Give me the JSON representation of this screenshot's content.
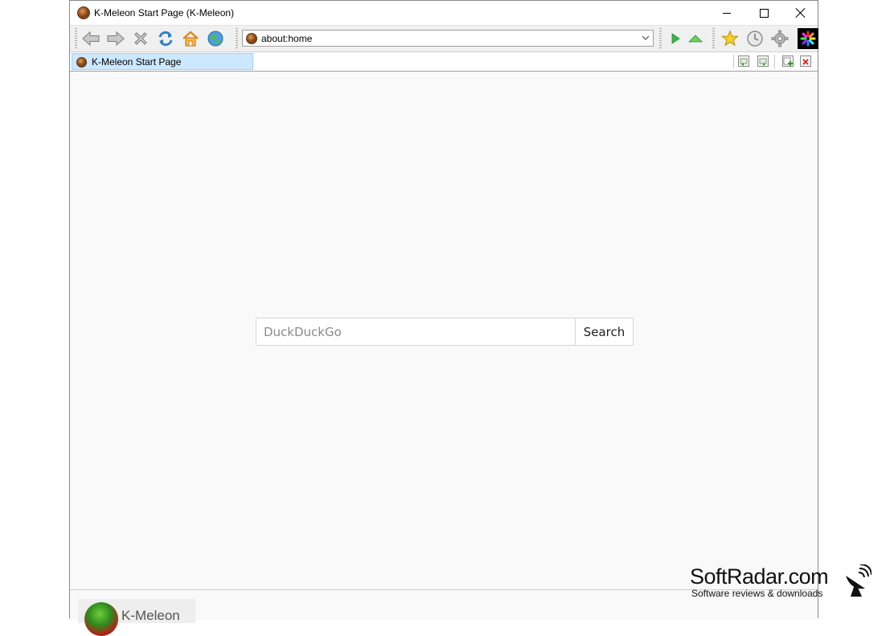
{
  "window": {
    "title": "K-Meleon Start Page (K-Meleon)"
  },
  "toolbar": {
    "back_icon": "back-arrow-icon",
    "forward_icon": "forward-arrow-icon",
    "stop_icon": "stop-x-icon",
    "reload_icon": "reload-icon",
    "home_icon": "home-icon",
    "globe_icon": "globe-icon",
    "go_icon": "go-play-icon",
    "up_icon": "up-triangle-icon",
    "bookmarks_icon": "star-icon",
    "history_icon": "clock-icon",
    "preferences_icon": "gear-icon",
    "throbber_icon": "kmeleon-throbber-icon"
  },
  "address_bar": {
    "value": "about:home"
  },
  "tabs": [
    {
      "label": "K-Meleon Start Page",
      "active": true
    }
  ],
  "content": {
    "search": {
      "placeholder": "DuckDuckGo",
      "button_label": "Search"
    },
    "logo_text": "K-Meleon"
  },
  "watermark": {
    "title": "SoftRadar.com",
    "subtitle": "Software reviews & downloads"
  },
  "colors": {
    "tab_active_bg": "#cce8ff",
    "page_bg": "#f9f9f9",
    "toolbar_bg": "#f0f0f0"
  }
}
